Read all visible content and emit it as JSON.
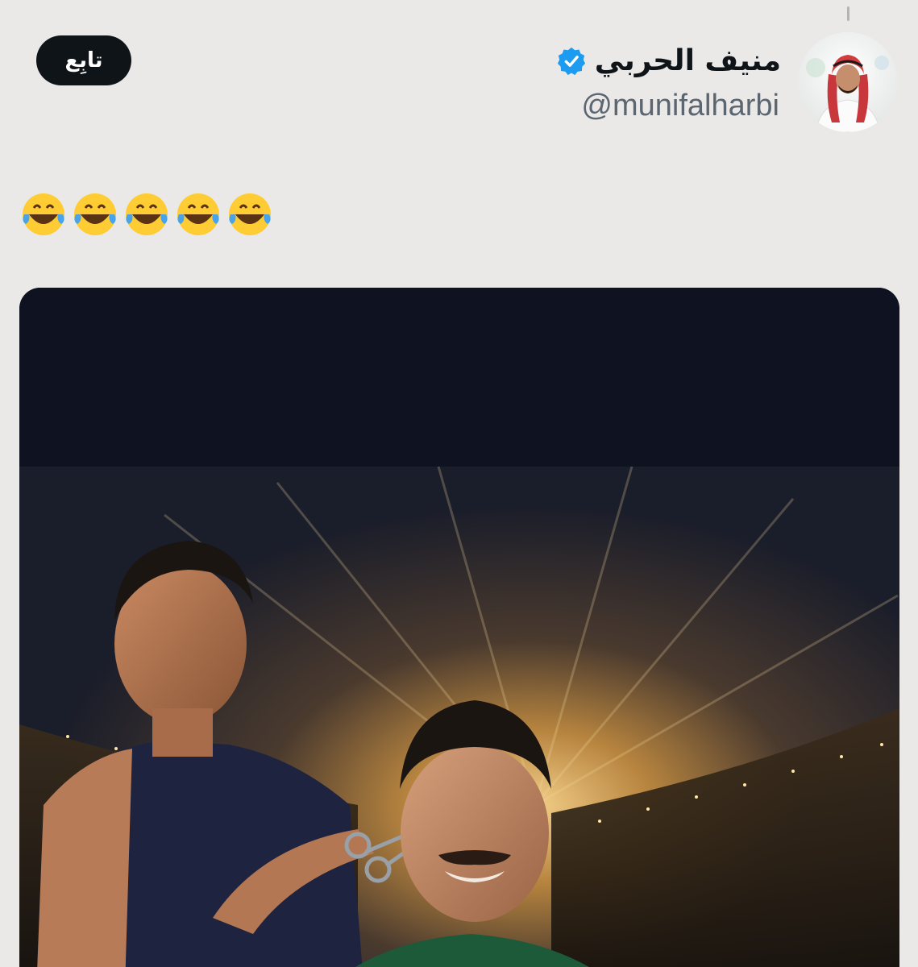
{
  "tweet": {
    "author": {
      "display_name": "منيف الحربي",
      "handle": "@munifalharbi",
      "verified": true,
      "verified_color": "#1d9bf0"
    },
    "follow_label": "تابِع",
    "text": "😂😂😂😂😂",
    "media": {
      "type": "photo"
    }
  },
  "colors": {
    "background": "#ebe9e8",
    "text_primary": "#0f1419",
    "text_secondary": "#5b6670",
    "button_bg": "#0f1419",
    "button_text": "#ffffff"
  }
}
